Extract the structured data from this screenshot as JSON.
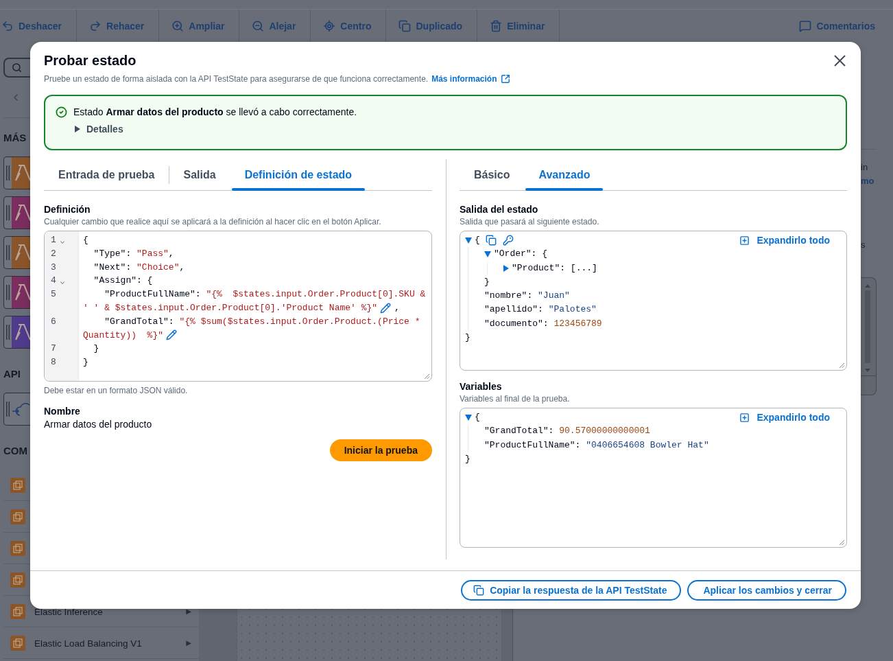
{
  "toolbar": {
    "items": [
      {
        "kind": "undo",
        "label": "Deshacer"
      },
      {
        "kind": "redo",
        "label": "Rehacer"
      },
      {
        "kind": "zoom_in",
        "label": "Ampliar"
      },
      {
        "kind": "zoom_out",
        "label": "Alejar"
      },
      {
        "kind": "center",
        "label": "Centro"
      },
      {
        "kind": "duplicate",
        "label": "Duplicado"
      },
      {
        "kind": "delete",
        "label": "Eliminar"
      }
    ],
    "end_items": [
      {
        "kind": "comments",
        "label": "Comentarios"
      }
    ]
  },
  "sidebar": {
    "sections": [
      {
        "kind": "tiles",
        "heading": "MÁS",
        "tiles": [
          {
            "kind": "service",
            "color": "#8a5529"
          },
          {
            "kind": "service",
            "color": "#7a2d5e"
          },
          {
            "kind": "service",
            "color": "#8a5529"
          },
          {
            "kind": "service",
            "color": "#7a2d5e"
          },
          {
            "kind": "service",
            "color": "#4e3b8c"
          }
        ]
      },
      {
        "kind": "tiles",
        "heading": "API",
        "tiles": [
          {
            "kind": "api"
          }
        ]
      },
      {
        "kind": "list",
        "heading": "COM",
        "items": [
          {
            "kind": "service"
          },
          {
            "kind": "service"
          },
          {
            "kind": "service"
          },
          {
            "kind": "service"
          },
          {
            "kind": "service",
            "label": "Elastic Inference",
            "arrow": "▶"
          },
          {
            "kind": "service",
            "label": "Elastic Load Balancing V1",
            "arrow": "▶"
          }
        ]
      }
    ]
  },
  "right_panel": {
    "fragments": [
      {
        "kind": "text",
        "text": "in"
      },
      {
        "kind": "link",
        "text": "mo"
      },
      {
        "kind": "text",
        "text": "s"
      }
    ]
  },
  "dialog": {
    "title": "Probar estado",
    "description": "Pruebe un estado de forma aislada con la API TestState para asegurarse de que funciona correctamente.",
    "link": "Más información",
    "alert": {
      "kind": "success",
      "message": "Estado **Armar datos del producto** se llevó a cabo correctamente.",
      "details": {
        "label": "Detalles",
        "expanded": false
      }
    },
    "left": {
      "tabs": [
        {
          "label": "Entrada de prueba",
          "selected": false
        },
        {
          "label": "Salida",
          "selected": false
        },
        {
          "label": "Definición de estado",
          "selected": true
        }
      ],
      "definition": {
        "label": "Definición",
        "description": "Cualquier cambio que realice aquí se aplicará a la definición al hacer clic en el botón Aplicar.",
        "constraint": "Debe estar en un formato JSON válido.",
        "lines": [
          {
            "number": "1",
            "foldable": true,
            "rows": [
              [
                {
                  "kind": "plain",
                  "text": "{"
                }
              ]
            ]
          },
          {
            "number": "2",
            "foldable": false,
            "rows": [
              [
                {
                  "kind": "plain",
                  "text": "  \"Type\": "
                },
                {
                  "kind": "string",
                  "text": "\"Pass\""
                },
                {
                  "kind": "plain",
                  "text": ","
                }
              ]
            ]
          },
          {
            "number": "3",
            "foldable": false,
            "rows": [
              [
                {
                  "kind": "plain",
                  "text": "  \"Next\": "
                },
                {
                  "kind": "string",
                  "text": "\"Choice\""
                },
                {
                  "kind": "plain",
                  "text": ","
                }
              ]
            ]
          },
          {
            "number": "4",
            "foldable": true,
            "rows": [
              [
                {
                  "kind": "plain",
                  "text": "  \"Assign\": {"
                }
              ]
            ]
          },
          {
            "number": "5",
            "foldable": false,
            "rows": [
              [
                {
                  "kind": "plain",
                  "text": "    \"ProductFullName\": "
                },
                {
                  "kind": "string",
                  "text": "\"{%  $states.input.Order.Product[0].SKU &"
                }
              ],
              [
                {
                  "kind": "string",
                  "text": "' ' & $states.input.Order.Product[0].'Product Name' %}\""
                },
                {
                  "kind": "edit"
                },
                {
                  "kind": "plain",
                  "text": ","
                }
              ]
            ]
          },
          {
            "number": "6",
            "foldable": false,
            "rows": [
              [
                {
                  "kind": "plain",
                  "text": "    \"GrandTotal\": "
                },
                {
                  "kind": "string",
                  "text": "\"{% $sum($states.input.Order.Product.(Price *"
                }
              ],
              [
                {
                  "kind": "string",
                  "text": "Quantity))  %}\""
                },
                {
                  "kind": "edit"
                }
              ]
            ]
          },
          {
            "number": "7",
            "foldable": false,
            "rows": [
              [
                {
                  "kind": "plain",
                  "text": "  }"
                }
              ]
            ]
          },
          {
            "number": "8",
            "foldable": false,
            "rows": [
              [
                {
                  "kind": "plain",
                  "text": "}"
                }
              ]
            ]
          }
        ]
      },
      "name": {
        "label": "Nombre",
        "value": "Armar datos del producto"
      },
      "run_button": "Iniciar la prueba"
    },
    "right": {
      "tabs": [
        {
          "label": "Básico",
          "selected": false
        },
        {
          "label": "Avanzado",
          "selected": true
        }
      ],
      "panels": [
        {
          "label": "Salida del estado",
          "description": "Salida que pasará al siguiente estado.",
          "expand_all": "Expandirlo todo",
          "root_actions": [
            {
              "kind": "copy"
            },
            {
              "kind": "key"
            }
          ],
          "tree": {
            "expanded": true,
            "open": "{",
            "close": "}",
            "children": [
              {
                "key": "\"Order\":",
                "expanded": true,
                "open": "{",
                "close": "}",
                "children": [
                  {
                    "key": "\"Product\":",
                    "expanded": false,
                    "summary": "[...]"
                  }
                ]
              },
              {
                "key": "\"nombre\":",
                "value": "\"Juan\"",
                "kind": "string"
              },
              {
                "key": "\"apellido\":",
                "value": "\"Palotes\"",
                "kind": "string"
              },
              {
                "key": "\"documento\":",
                "value": "123456789",
                "kind": "number"
              }
            ]
          }
        },
        {
          "label": "Variables",
          "description": "Variables al final de la prueba.",
          "expand_all": "Expandirlo todo",
          "tree": {
            "expanded": true,
            "open": "{",
            "close": "}",
            "children": [
              {
                "key": "\"GrandTotal\":",
                "value": "90.57000000000001",
                "kind": "number"
              },
              {
                "key": "\"ProductFullName\":",
                "value": "\"0406654608 Bowler Hat\"",
                "kind": "string"
              }
            ]
          }
        }
      ]
    },
    "footer": {
      "buttons": [
        {
          "kind": "copy",
          "label": "Copiar la respuesta de la API TestState"
        },
        {
          "kind": "apply",
          "label": "Aplicar los cambios y cerrar"
        }
      ]
    }
  }
}
